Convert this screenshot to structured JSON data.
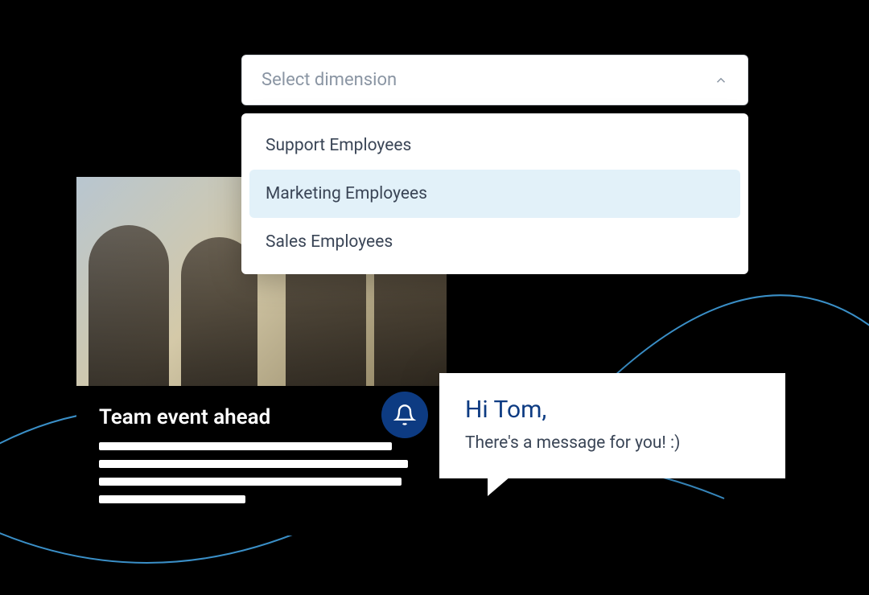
{
  "dropdown": {
    "placeholder": "Select dimension",
    "options": [
      {
        "label": "Support Employees",
        "highlighted": false
      },
      {
        "label": "Marketing Employees",
        "highlighted": true
      },
      {
        "label": "Sales Employees",
        "highlighted": false
      }
    ]
  },
  "event_card": {
    "title": "Team event ahead"
  },
  "notification": {
    "icon": "bell-icon",
    "greeting": "Hi Tom,",
    "body": "There's a message for you! :)"
  },
  "colors": {
    "accent_blue": "#0d3b82",
    "highlight_bg": "#e2f1f9",
    "wave_stroke": "#3a8fc7"
  }
}
